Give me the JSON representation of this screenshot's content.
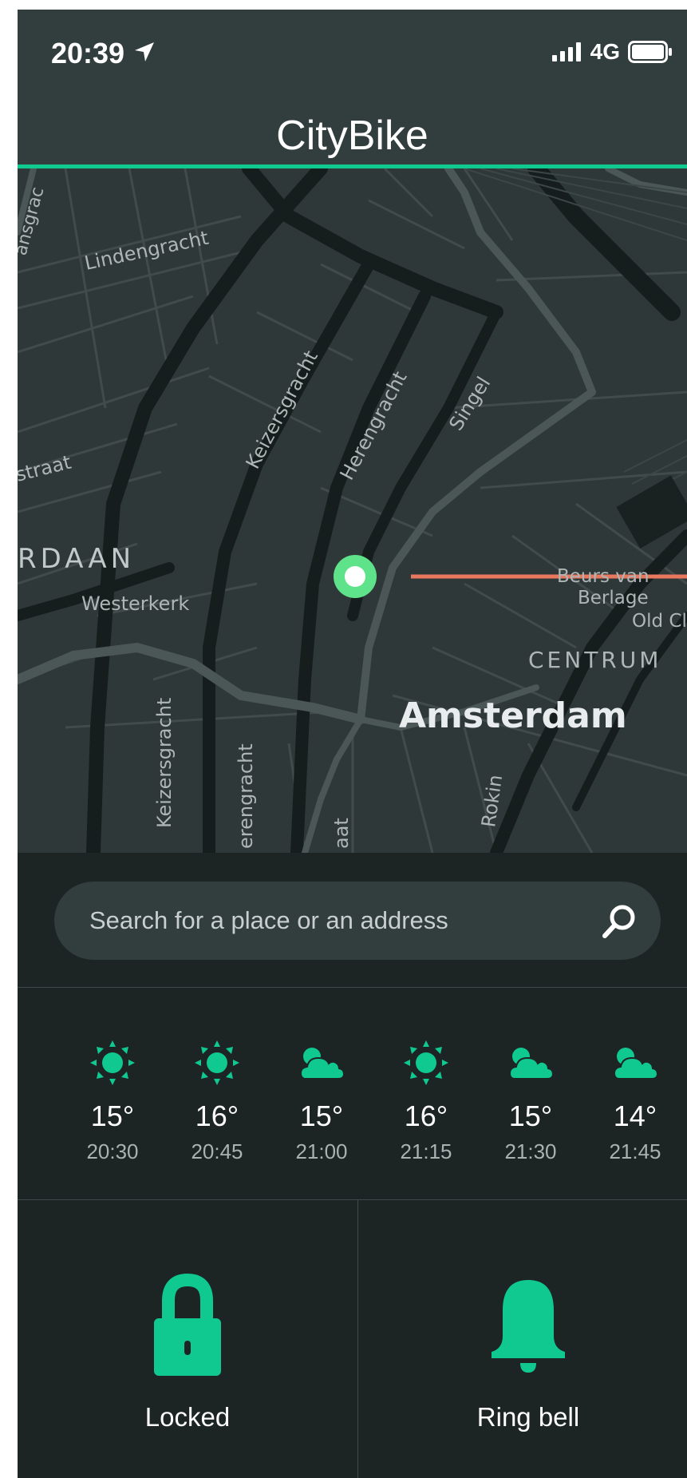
{
  "status_bar": {
    "time": "20:39",
    "network": "4G",
    "icons": [
      "location-arrow-icon",
      "signal-bars-icon",
      "battery-icon"
    ]
  },
  "header": {
    "title": "CityBike"
  },
  "map": {
    "street_labels": {
      "lindengracht": "Lindengracht",
      "keizersgracht_top": "Keizersgracht",
      "herengracht_top": "Herengracht",
      "singel": "Singel",
      "straat": "straat",
      "jordaan": "RDAAN",
      "westerkerk": "Westerkerk",
      "beurs_line1": "Beurs van",
      "beurs_line2": "Berlage",
      "old": "Old Cl",
      "centrum": "CENTRUM",
      "amsterdam": "Amsterdam",
      "keizersgracht_bottom": "Keizersgracht",
      "herengracht_bottom": "erengracht",
      "rokin": "Rokin",
      "aat": "aat",
      "top_left": "ansgrac"
    },
    "colors": {
      "background": "#2f3838",
      "canal": "#1a2121",
      "street": "#424c4c",
      "pin": "#5fe38a",
      "route": "#e8785e"
    }
  },
  "search": {
    "placeholder": "Search for a place or an address",
    "value": ""
  },
  "forecast": [
    {
      "icon": "sun-icon",
      "temp": "15°",
      "time": "20:30"
    },
    {
      "icon": "sun-icon",
      "temp": "16°",
      "time": "20:45"
    },
    {
      "icon": "cloud-sun-icon",
      "temp": "15°",
      "time": "21:00"
    },
    {
      "icon": "sun-icon",
      "temp": "16°",
      "time": "21:15"
    },
    {
      "icon": "cloud-sun-icon",
      "temp": "15°",
      "time": "21:30"
    },
    {
      "icon": "cloud-sun-icon",
      "temp": "14°",
      "time": "21:45"
    }
  ],
  "actions": {
    "lock": {
      "label": "Locked",
      "icon": "lock-icon"
    },
    "bell": {
      "label": "Ring bell",
      "icon": "bell-icon"
    }
  },
  "colors": {
    "accent": "#10c990",
    "header_bg": "#323d3d",
    "panel_bg": "#1c2424"
  }
}
